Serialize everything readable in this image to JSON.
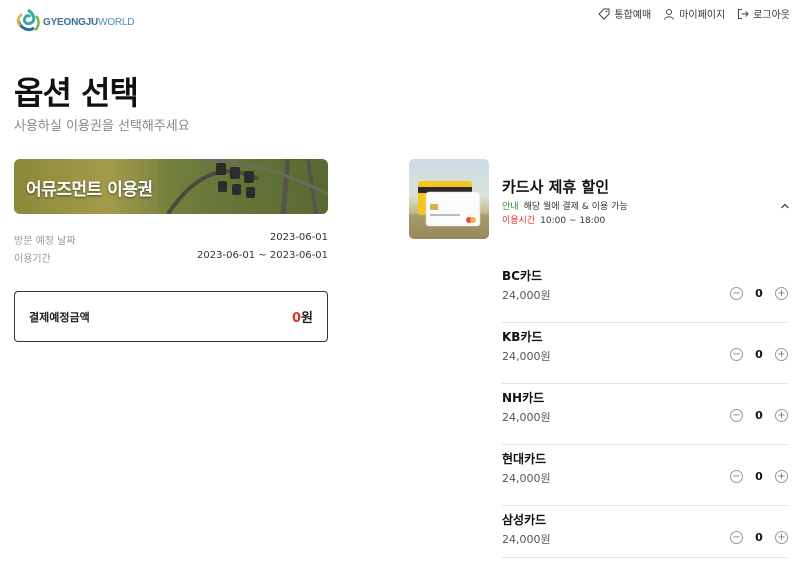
{
  "header": {
    "logo_prefix": "GYEONGJU",
    "logo_suffix": "WORLD",
    "nav": [
      {
        "label": "통합예매",
        "icon": "tag-icon"
      },
      {
        "label": "마이페이지",
        "icon": "user-icon"
      },
      {
        "label": "로그아웃",
        "icon": "logout-icon"
      }
    ]
  },
  "page": {
    "title": "옵션 선택",
    "subtitle": "사용하실 이용권을 선택해주세요"
  },
  "ticket_banner": {
    "title": "어뮤즈먼트 이용권"
  },
  "visit_info": {
    "visit_date_label": "방문 예정 날짜",
    "visit_date_value": "2023-06-01",
    "period_label": "이용기간",
    "period_value": "2023-06-01 ~ 2023-06-01"
  },
  "total": {
    "label": "결제예정금액",
    "amount": "0",
    "unit": "원"
  },
  "product": {
    "title": "카드사 제휴 할인",
    "notice_tag": "안내",
    "notice_text": "해당 월에 결제 & 이용 가능",
    "hours_tag": "이용시간",
    "hours_text": "10:00 ~ 18:00"
  },
  "options": [
    {
      "name": "BC카드",
      "price": "24,000원",
      "qty": "0"
    },
    {
      "name": "KB카드",
      "price": "24,000원",
      "qty": "0"
    },
    {
      "name": "NH카드",
      "price": "24,000원",
      "qty": "0"
    },
    {
      "name": "현대카드",
      "price": "24,000원",
      "qty": "0"
    },
    {
      "name": "삼성카드",
      "price": "24,000원",
      "qty": "0"
    }
  ],
  "stepper": {
    "minus": "−",
    "plus": "+"
  }
}
